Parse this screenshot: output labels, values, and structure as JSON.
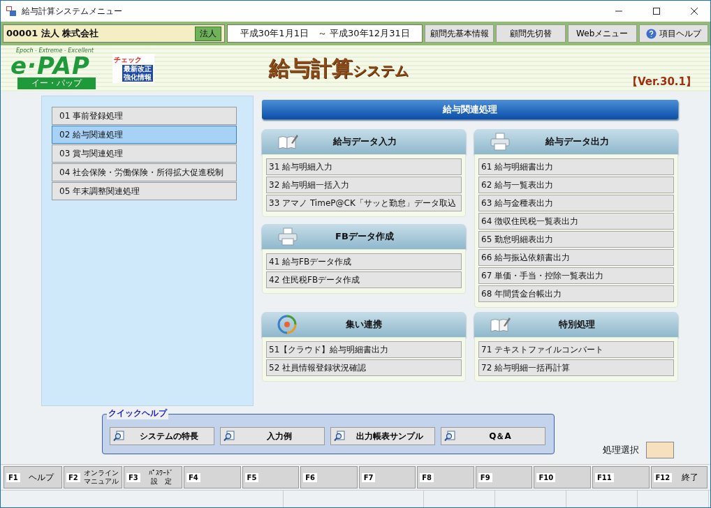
{
  "window": {
    "title": "給与計算システムメニュー"
  },
  "toolbar": {
    "company": "00001 法人 株式会社",
    "company_type": "法人",
    "period": "平成30年1月1日　～ 平成30年12月31日",
    "buttons": [
      "顧問先基本情報",
      "顧問先切替",
      "Webメニュー",
      "項目ヘルプ"
    ]
  },
  "banner": {
    "logo": {
      "tagline": "Epoch - Extreme - Excellent",
      "name": "e·PAP",
      "reading": "イー・パップ"
    },
    "badge": {
      "top": "チェック",
      "lines": [
        "最新改正",
        "強化情報"
      ]
    },
    "title_main": "給与計算",
    "title_sub": "システム",
    "version": "【Ver.30.1】"
  },
  "menu": [
    {
      "label": "01 事前登録処理",
      "selected": false
    },
    {
      "label": "02 給与関連処理",
      "selected": true
    },
    {
      "label": "03 賞与関連処理",
      "selected": false
    },
    {
      "label": "04 社会保険・労働保険・所得拡大促進税制",
      "selected": false
    },
    {
      "label": "05 年末調整関連処理",
      "selected": false
    }
  ],
  "section_title": "給与関連処理",
  "group_rows": [
    [
      [
        {
          "title": "給与データ入力",
          "kind": "input",
          "items": [
            "31 給与明細入力",
            "32 給与明細一括入力",
            "33 アマノ TimeP@CK「サッと勤怠」データ取込"
          ]
        },
        {
          "title": "FBデータ作成",
          "kind": "output",
          "items": [
            "41 給与FBデータ作成",
            "42 住民税FBデータ作成"
          ]
        }
      ],
      [
        {
          "title": "給与データ出力",
          "kind": "output",
          "items": [
            "61 給与明細書出力",
            "62 給与一覧表出力",
            "63 給与金種表出力",
            "64 徴収住民税一覧表出力",
            "65 勤怠明細表出力",
            "66 給与振込依頼書出力",
            "67 単価・手当・控除一覧表出力",
            "68 年間賃金台帳出力"
          ]
        }
      ]
    ],
    [
      [
        {
          "title": "集い連携",
          "kind": "link",
          "items": [
            "51【クラウド】給与明細書出力",
            "52 社員情報登録状況確認"
          ]
        }
      ],
      [
        {
          "title": "特別処理",
          "kind": "input",
          "items": [
            "71 テキストファイルコンバート",
            "72 給与明細一括再計算"
          ]
        }
      ]
    ]
  ],
  "quick_help": {
    "legend": "クイックヘルプ",
    "buttons": [
      "システムの特長",
      "入力例",
      "出力帳表サンプル",
      "Q＆A"
    ]
  },
  "selection": {
    "label": "処理選択"
  },
  "function_keys": [
    {
      "key": "F1",
      "lines": [
        "ヘルプ"
      ]
    },
    {
      "key": "F2",
      "lines": [
        "オンライン",
        "マニュアル"
      ]
    },
    {
      "key": "F3",
      "lines": [
        "ﾊﾟｽﾜｰﾄﾞ",
        "設　定"
      ]
    },
    {
      "key": "F4"
    },
    {
      "key": "F5"
    },
    {
      "key": "F6"
    },
    {
      "key": "F7"
    },
    {
      "key": "F8"
    },
    {
      "key": "F9"
    },
    {
      "key": "F10"
    },
    {
      "key": "F11"
    },
    {
      "key": "F12",
      "lines": [
        "終了"
      ]
    }
  ]
}
